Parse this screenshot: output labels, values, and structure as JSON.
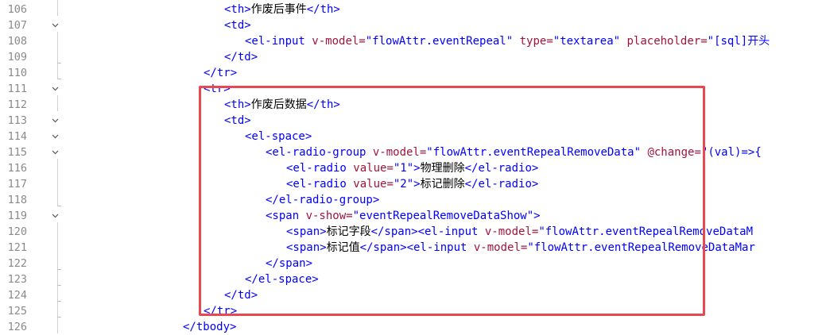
{
  "editor": {
    "lines": [
      {
        "num": "106",
        "indent": 8,
        "fold": false,
        "guide": "mid",
        "parts": [
          [
            "tag",
            "<th>"
          ],
          [
            "txt",
            "作废后事件"
          ],
          [
            "tag",
            "</th>"
          ]
        ]
      },
      {
        "num": "107",
        "indent": 8,
        "fold": true,
        "guide": "none",
        "parts": [
          [
            "tag",
            "<td>"
          ]
        ]
      },
      {
        "num": "108",
        "indent": 9,
        "fold": false,
        "guide": "mid",
        "parts": [
          [
            "tag",
            "<el-input "
          ],
          [
            "attr",
            "v-model="
          ],
          [
            "val",
            "\"flowAttr.eventRepeal\" "
          ],
          [
            "attr",
            "type="
          ],
          [
            "val",
            "\"textarea\" "
          ],
          [
            "attr",
            "placeholder="
          ],
          [
            "val",
            "\"[sql]开头"
          ]
        ]
      },
      {
        "num": "109",
        "indent": 8,
        "fold": false,
        "guide": "end",
        "parts": [
          [
            "tag",
            "</td>"
          ]
        ]
      },
      {
        "num": "110",
        "indent": 7,
        "fold": false,
        "guide": "end",
        "parts": [
          [
            "tag",
            "</tr>"
          ]
        ]
      },
      {
        "num": "111",
        "indent": 7,
        "fold": true,
        "guide": "none",
        "parts": [
          [
            "tag",
            "<tr>"
          ]
        ]
      },
      {
        "num": "112",
        "indent": 8,
        "fold": false,
        "guide": "mid",
        "parts": [
          [
            "tag",
            "<th>"
          ],
          [
            "txt",
            "作废后数据"
          ],
          [
            "tag",
            "</th>"
          ]
        ]
      },
      {
        "num": "113",
        "indent": 8,
        "fold": true,
        "guide": "none",
        "parts": [
          [
            "tag",
            "<td>"
          ]
        ]
      },
      {
        "num": "114",
        "indent": 9,
        "fold": true,
        "guide": "none",
        "parts": [
          [
            "tag",
            "<el-space>"
          ]
        ]
      },
      {
        "num": "115",
        "indent": 10,
        "fold": true,
        "guide": "none",
        "parts": [
          [
            "tag",
            "<el-radio-group "
          ],
          [
            "attr",
            "v-model="
          ],
          [
            "val",
            "\"flowAttr.eventRepealRemoveData\" "
          ],
          [
            "attr",
            "@change="
          ],
          [
            "val",
            "\"(val)=>{"
          ]
        ]
      },
      {
        "num": "116",
        "indent": 11,
        "fold": false,
        "guide": "mid",
        "parts": [
          [
            "tag",
            "<el-radio "
          ],
          [
            "attr",
            "value="
          ],
          [
            "val",
            "\"1\""
          ],
          [
            "tag",
            ">"
          ],
          [
            "txt",
            "物理删除"
          ],
          [
            "tag",
            "</el-radio>"
          ]
        ]
      },
      {
        "num": "117",
        "indent": 11,
        "fold": false,
        "guide": "mid",
        "parts": [
          [
            "tag",
            "<el-radio "
          ],
          [
            "attr",
            "value="
          ],
          [
            "val",
            "\"2\""
          ],
          [
            "tag",
            ">"
          ],
          [
            "txt",
            "标记删除"
          ],
          [
            "tag",
            "</el-radio>"
          ]
        ]
      },
      {
        "num": "118",
        "indent": 10,
        "fold": false,
        "guide": "end",
        "parts": [
          [
            "tag",
            "</el-radio-group>"
          ]
        ]
      },
      {
        "num": "119",
        "indent": 10,
        "fold": true,
        "guide": "none",
        "parts": [
          [
            "tag",
            "<span "
          ],
          [
            "attr",
            "v-show="
          ],
          [
            "val",
            "\"eventRepealRemoveDataShow\""
          ],
          [
            "tag",
            ">"
          ]
        ]
      },
      {
        "num": "120",
        "indent": 11,
        "fold": false,
        "guide": "mid",
        "parts": [
          [
            "tag",
            "<span>"
          ],
          [
            "txt",
            "标记字段"
          ],
          [
            "tag",
            "</span><el-input "
          ],
          [
            "attr",
            "v-model="
          ],
          [
            "val",
            "\"flowAttr.eventRepealRemoveDataM"
          ]
        ]
      },
      {
        "num": "121",
        "indent": 11,
        "fold": false,
        "guide": "mid",
        "parts": [
          [
            "tag",
            "<span>"
          ],
          [
            "txt",
            "标记值"
          ],
          [
            "tag",
            "</span><el-input "
          ],
          [
            "attr",
            "v-model="
          ],
          [
            "val",
            "\"flowAttr.eventRepealRemoveDataMar"
          ]
        ]
      },
      {
        "num": "122",
        "indent": 10,
        "fold": false,
        "guide": "end",
        "parts": [
          [
            "tag",
            "</span>"
          ]
        ]
      },
      {
        "num": "123",
        "indent": 9,
        "fold": false,
        "guide": "end",
        "parts": [
          [
            "tag",
            "</el-space>"
          ]
        ]
      },
      {
        "num": "124",
        "indent": 8,
        "fold": false,
        "guide": "end",
        "parts": [
          [
            "tag",
            "</td>"
          ]
        ]
      },
      {
        "num": "125",
        "indent": 7,
        "fold": false,
        "guide": "end",
        "parts": [
          [
            "tag",
            "</tr>"
          ]
        ]
      },
      {
        "num": "126",
        "indent": 6,
        "fold": false,
        "guide": "mid",
        "parts": [
          [
            "tag",
            "</tbody>"
          ]
        ]
      }
    ]
  },
  "colors": {
    "tag": "#0000ff",
    "attribute": "#a0143c",
    "value": "#0000ff",
    "text": "#000000",
    "highlight_border": "#e8484f"
  }
}
